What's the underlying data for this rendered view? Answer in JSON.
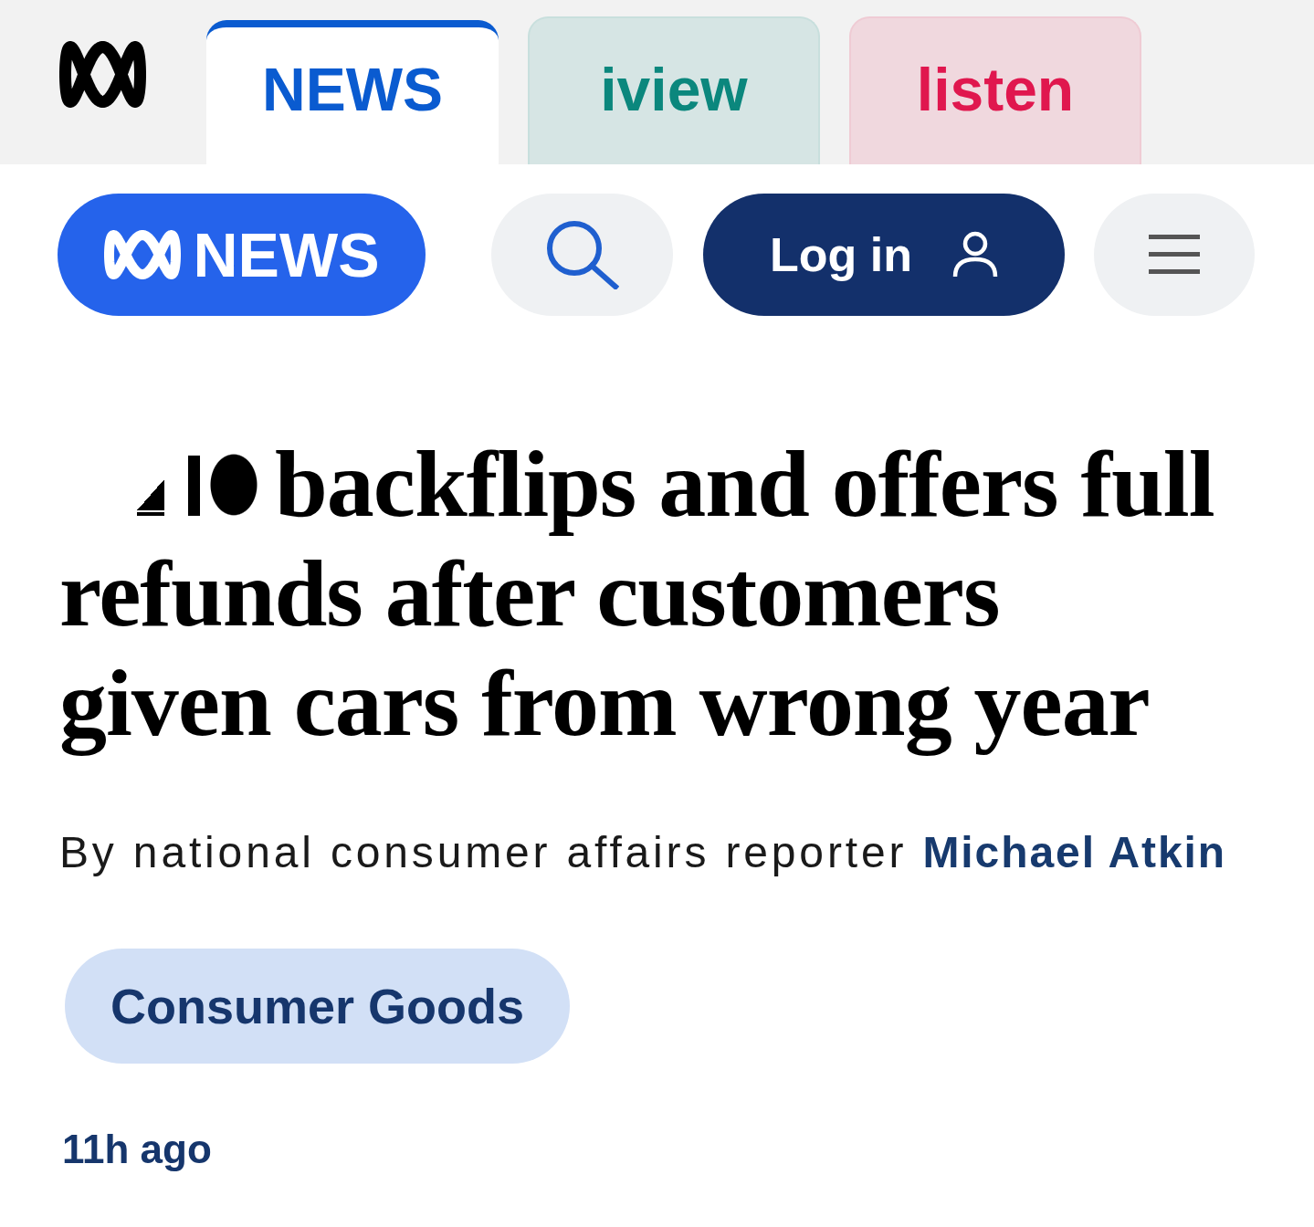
{
  "tabs": [
    {
      "label": "NEWS",
      "selected": true,
      "color": "#0a5bd0"
    },
    {
      "label": "iview",
      "selected": false,
      "color": "#0b877d"
    },
    {
      "label": "listen",
      "selected": false,
      "color": "#e0174e"
    }
  ],
  "header": {
    "home_button": {
      "label": "NEWS"
    },
    "login_button": {
      "label": "Log in"
    }
  },
  "article": {
    "headline": "backflips and offers full refunds after customers given cars from wrong year",
    "byline": {
      "text": "By national consumer affairs reporter",
      "author": "Michael Atkin"
    },
    "topic_tag": "Consumer Goods",
    "timestamp": "11h ago"
  }
}
